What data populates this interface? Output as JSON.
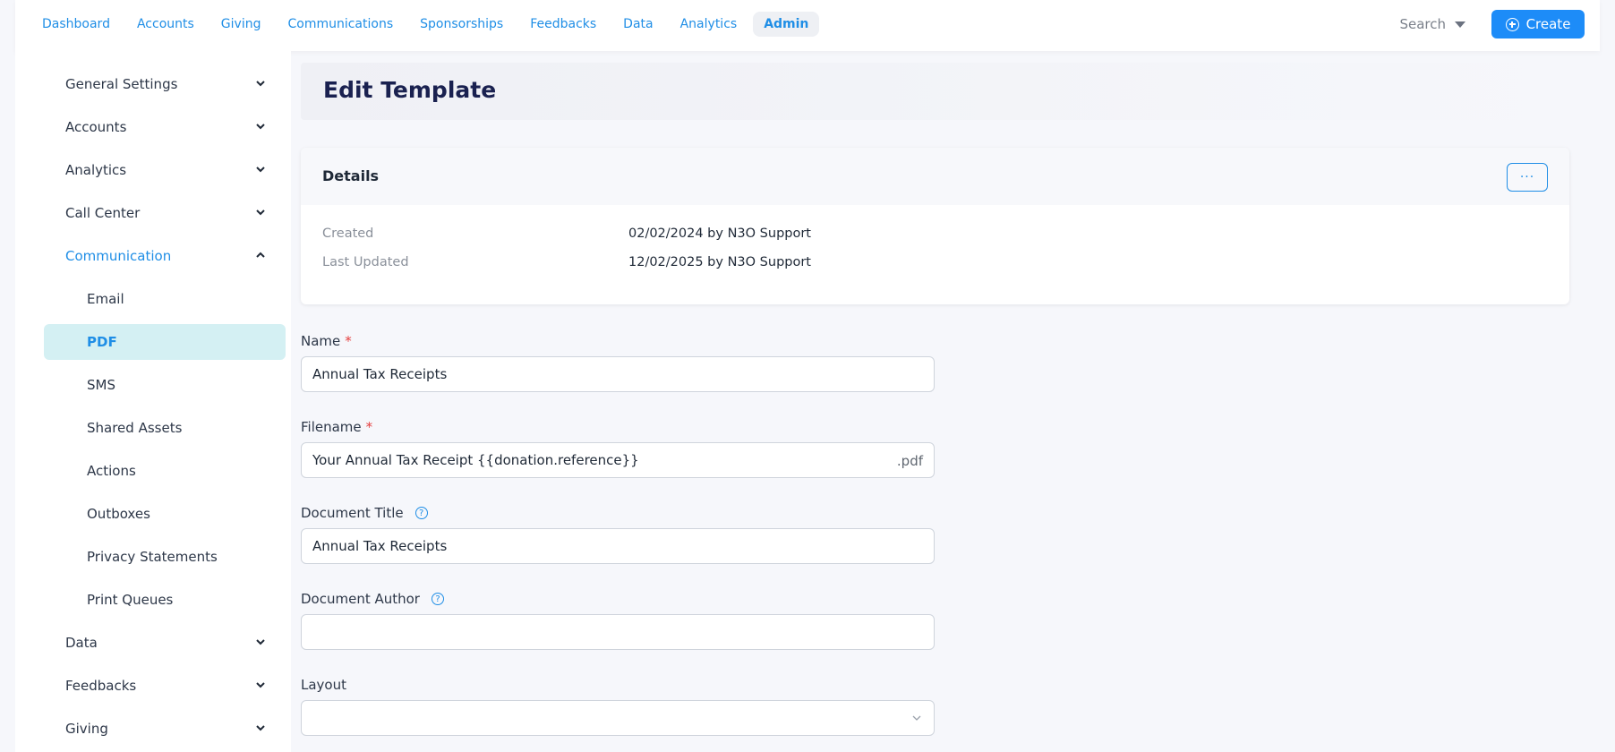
{
  "nav": {
    "items": [
      "Dashboard",
      "Accounts",
      "Giving",
      "Communications",
      "Sponsorships",
      "Feedbacks",
      "Data",
      "Analytics",
      "Admin"
    ],
    "active": "Admin"
  },
  "search": {
    "label": "Search"
  },
  "create": {
    "label": "Create"
  },
  "sidebar": {
    "groups": [
      {
        "label": "General Settings",
        "icon": "chevron-down-icon"
      },
      {
        "label": "Accounts",
        "icon": "chevron-down-icon"
      },
      {
        "label": "Analytics",
        "icon": "chevron-down-icon"
      },
      {
        "label": "Call Center",
        "icon": "chevron-down-icon"
      },
      {
        "label": "Communication",
        "icon": "chevron-up-icon"
      }
    ],
    "communication_items": [
      "Email",
      "PDF",
      "SMS",
      "Shared Assets",
      "Actions",
      "Outboxes",
      "Privacy Statements",
      "Print Queues"
    ],
    "active_item": "PDF",
    "bottom_groups": [
      {
        "label": "Data",
        "icon": "chevron-down-icon"
      },
      {
        "label": "Feedbacks",
        "icon": "chevron-down-icon"
      },
      {
        "label": "Giving",
        "icon": "chevron-down-icon"
      }
    ]
  },
  "page": {
    "title": "Edit Template"
  },
  "details": {
    "title": "Details",
    "more_label": "···",
    "created_label": "Created",
    "created_value": "02/02/2024 by N3O Support",
    "updated_label": "Last Updated",
    "updated_value": "12/02/2025 by N3O Support"
  },
  "form": {
    "name_label": "Name",
    "name_value": "Annual Tax Receipts",
    "filename_label": "Filename",
    "filename_value": "Your Annual Tax Receipt {{donation.reference}}",
    "filename_suffix": ".pdf",
    "doc_title_label": "Document Title",
    "doc_title_value": "Annual Tax Receipts",
    "doc_author_label": "Document Author",
    "doc_author_value": "",
    "layout_label": "Layout",
    "layout_value": "",
    "required_mark": "*",
    "help_glyph": "?"
  },
  "colors": {
    "accent": "#1f8ee6",
    "create_button": "#1d8cf8",
    "active_sidebar_bg": "#d4f0f3",
    "title_text": "#1a2150",
    "required": "#e53e3e"
  }
}
